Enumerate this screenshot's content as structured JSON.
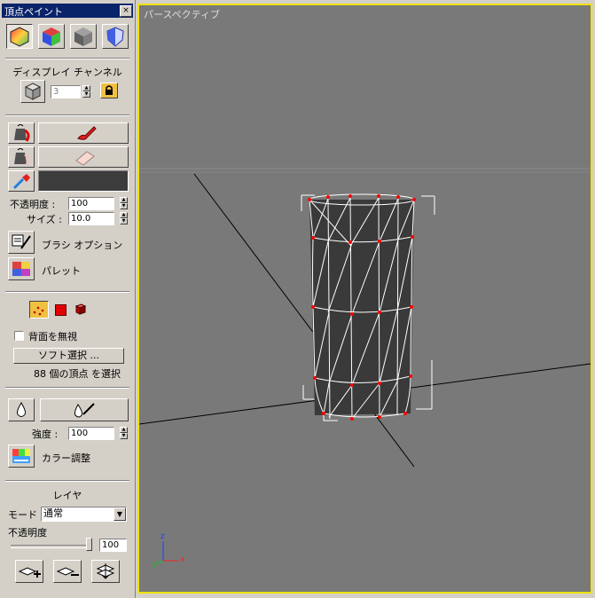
{
  "panel": {
    "title": "頂点ペイント",
    "close": "×",
    "display_channel_label": "ディスプレイ チャンネル",
    "channel_value": "3",
    "opacity_label": "不透明度 :",
    "opacity_value": "100",
    "size_label": "サイズ :",
    "size_value": "10.0",
    "brush_options_label": "ブラシ オプション",
    "palette_label": "パレット",
    "ignore_backfacing_label": "背面を無視",
    "soft_select_label": "ソフト選択 ...",
    "selection_status": "88 個の頂点 を選択",
    "strength_label": "強度 :",
    "strength_value": "100",
    "color_adjust_label": "カラー調整",
    "layer_label": "レイヤ",
    "mode_label": "モード",
    "mode_value": "通常",
    "layer_opacity_label": "不透明度",
    "layer_opacity_value": "100",
    "layer_opacity_level": 1.0,
    "paint_color": "#3c3c3c"
  },
  "viewport": {
    "label": "パースペクティブ",
    "border_color": "#f0e000",
    "axis_x": "x",
    "axis_y": "y",
    "axis_z": "z"
  }
}
